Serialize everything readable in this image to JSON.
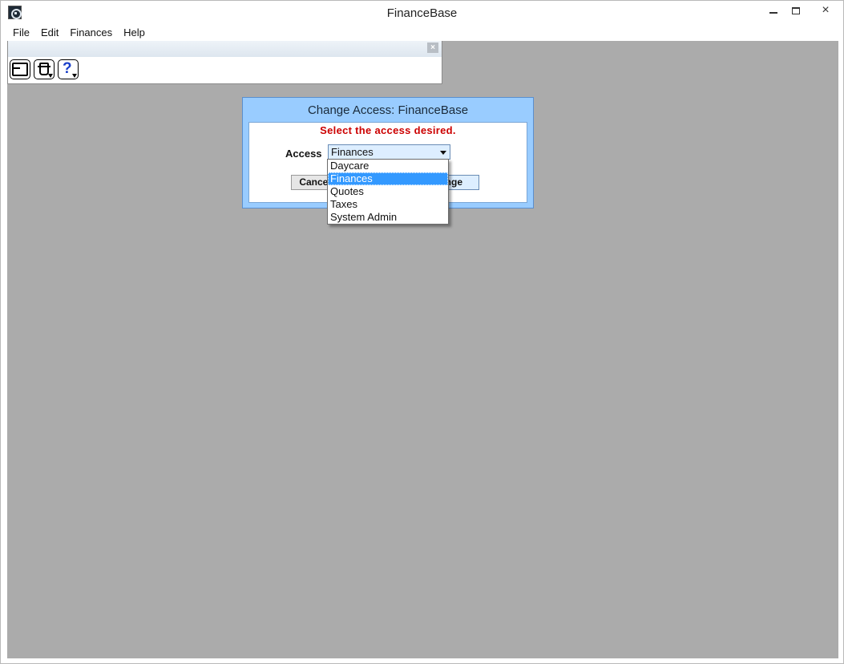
{
  "window": {
    "title": "FinanceBase",
    "icon": "finance-app-icon",
    "controls": {
      "minimize": "minimize-icon",
      "maximize": "maximize-icon",
      "close": "×"
    }
  },
  "menubar": {
    "items": [
      "File",
      "Edit",
      "Finances",
      "Help"
    ]
  },
  "toolbar": {
    "close_label": "×",
    "buttons": [
      "window-icon",
      "trash-can-icon",
      "help-icon"
    ],
    "help_glyph": "?"
  },
  "dialog": {
    "title": "Change Access: FinanceBase",
    "message": "Select the access desired.",
    "access_label": "Access",
    "access_value": "Finances",
    "cancel_label": "Cancel",
    "change_label": "Change"
  },
  "dropdown": {
    "options": [
      "Daycare",
      "Finances",
      "Quotes",
      "Taxes",
      "System Admin"
    ],
    "selected": "Finances"
  },
  "colors": {
    "dialog_frame": "#99ccff",
    "message": "#cc0000",
    "workspace": "#ababab",
    "selection": "#3399ff"
  }
}
